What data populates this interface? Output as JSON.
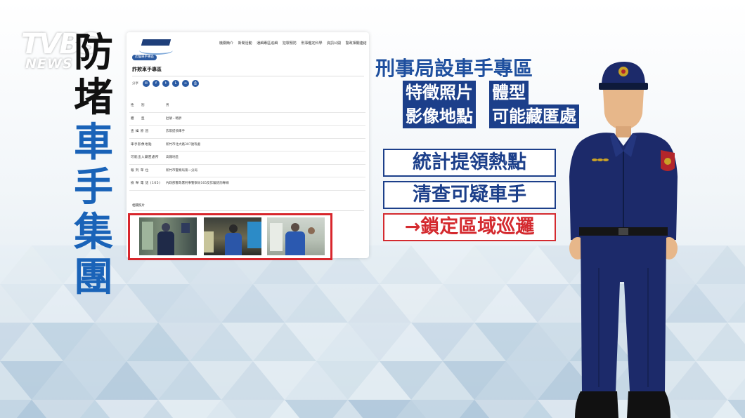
{
  "logo": {
    "main": "TVBS",
    "sub": "NEWS"
  },
  "headline": {
    "chars": [
      "防",
      "堵",
      "車",
      "手",
      "集",
      "團"
    ]
  },
  "webpage": {
    "nav": [
      "機關簡介",
      "新聞活動",
      "通緝專區追緝",
      "犯罪預防",
      "刑事鑑定科學",
      "資訊公開",
      "警政相關連結"
    ],
    "breadcrumb": "詐騙車手專區",
    "title": "詐欺車手專區",
    "share_label": "分享",
    "share_icons": [
      "mail-icon",
      "facebook-icon",
      "twitter-icon",
      "line-icon",
      "link-icon",
      "print-icon"
    ],
    "rows": [
      {
        "label": "性　　別",
        "value": "男"
      },
      {
        "label": "體　　型",
        "value": "肚碩・略胖"
      },
      {
        "label": "查 緝 原 因",
        "value": "詐欺提領車手"
      },
      {
        "label": "車手影像地點",
        "value": "新竹市北大路307號等處"
      },
      {
        "label": "可能出入藏匿處所",
        "value": "高鐵地區"
      },
      {
        "label": "報 列 單 位",
        "value": "新竹市警察局第一分局"
      },
      {
        "label": "檢 舉 電 話 (165)",
        "value": "內政部警政署刑事警察局165反詐騙諮詢專線"
      }
    ],
    "photos_label": "相關照片"
  },
  "right": {
    "title": "刑事局設車手專區",
    "tags": [
      "特徵照片",
      "體型",
      "影像地點",
      "可能藏匿處"
    ],
    "boxes": [
      "統計提領熱點",
      "清查可疑車手",
      "→鎖定區域巡邏"
    ]
  },
  "colors": {
    "headline_black": "#111111",
    "headline_blue": "#1a63b8",
    "tag_bg": "#1c3f8a",
    "highlight_red": "#d42a2f",
    "uniform_navy": "#1c2a6a"
  }
}
